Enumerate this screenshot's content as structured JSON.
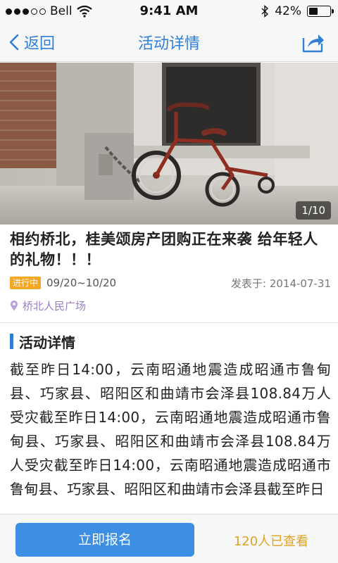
{
  "status_bar": {
    "carrier": "Bell",
    "time": "9:41 AM",
    "battery_percent": "42%",
    "battery_level": 0.42,
    "signal_bars_on": 3,
    "signal_bars_total": 5
  },
  "nav": {
    "back_label": "返回",
    "title": "活动详情",
    "share_icon": "share-icon",
    "accent_color": "#2f7fd8"
  },
  "hero": {
    "counter": "1/10"
  },
  "event": {
    "title": "相约桥北，桂美颂房产团购正在来袭  给年轻人的礼物！！！",
    "status_badge": "进行中",
    "date_range": "09/20~10/20",
    "published": "发表于: 2014-07-31",
    "location": "桥北人民广场"
  },
  "details": {
    "section_title": "活动详情",
    "body": "截至昨日14:00，云南昭通地震造成昭通市鲁甸县、巧家县、昭阳区和曲靖市会泽县108.84万人受灾截至昨日14:00，云南昭通地震造成昭通市鲁甸县、巧家县、昭阳区和曲靖市会泽县108.84万人受灾截至昨日14:00，云南昭通地震造成昭通市鲁甸县、巧家县、昭阳区和曲靖市会泽县截至昨日"
  },
  "bottom": {
    "signup_label": "立即报名",
    "viewed_text": "120人已查看"
  }
}
